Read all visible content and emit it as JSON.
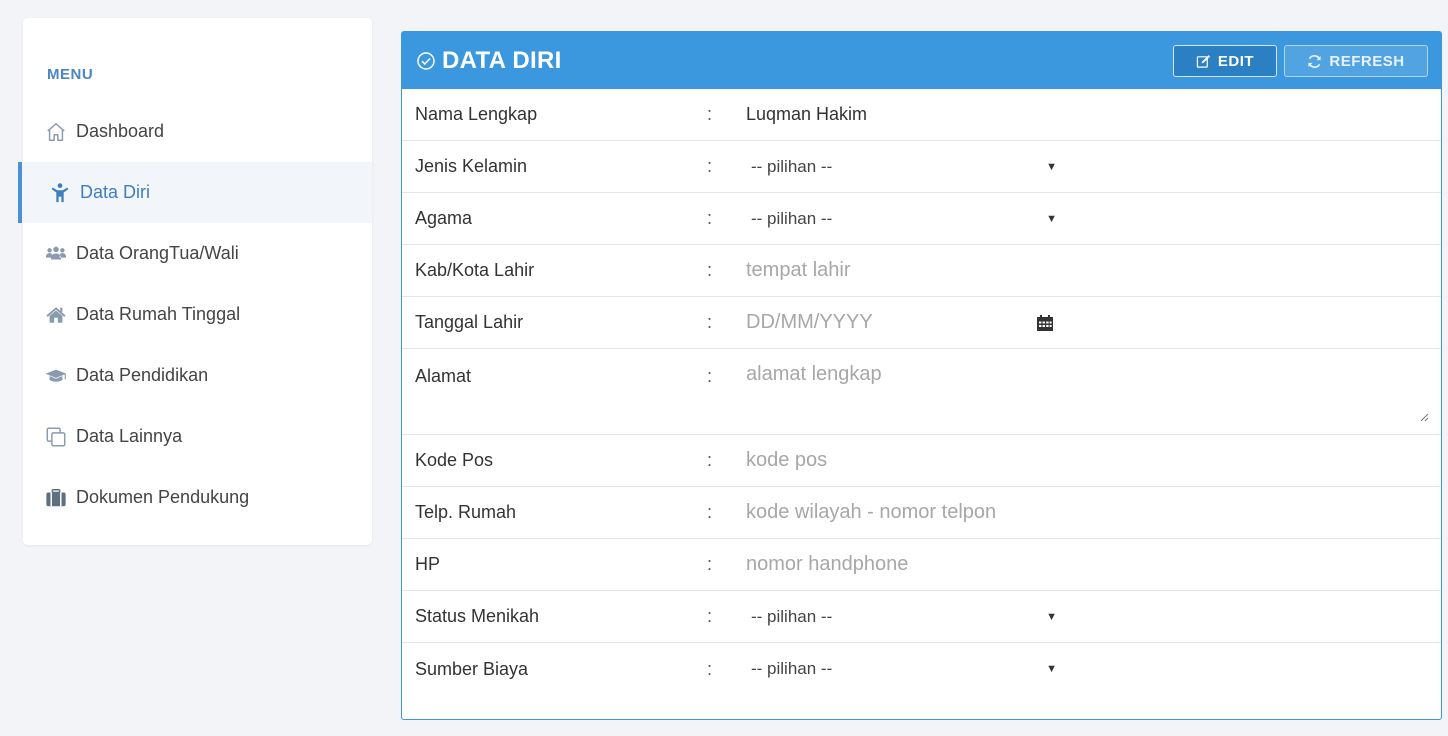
{
  "sidebar": {
    "heading": "MENU",
    "items": [
      {
        "label": "Dashboard",
        "icon": "home-outline-icon",
        "active": false
      },
      {
        "label": "Data Diri",
        "icon": "child-icon",
        "active": true
      },
      {
        "label": "Data OrangTua/Wali",
        "icon": "users-icon",
        "active": false
      },
      {
        "label": "Data Rumah Tinggal",
        "icon": "house-icon",
        "active": false
      },
      {
        "label": "Data Pendidikan",
        "icon": "graduation-cap-icon",
        "active": false
      },
      {
        "label": "Data Lainnya",
        "icon": "clone-icon",
        "active": false
      },
      {
        "label": "Dokumen Pendukung",
        "icon": "suitcase-icon",
        "active": false
      }
    ]
  },
  "panel": {
    "title": "DATA DIRI",
    "title_icon": "check-circle-icon",
    "edit_label": "EDIT",
    "refresh_label": "REFRESH",
    "colon": ":",
    "fields": {
      "nama": {
        "label": "Nama Lengkap",
        "value": "Luqman Hakim"
      },
      "jenis_kelamin": {
        "label": "Jenis Kelamin",
        "selected": "-- pilihan --"
      },
      "agama": {
        "label": "Agama",
        "selected": "-- pilihan --"
      },
      "kota_lahir": {
        "label": "Kab/Kota Lahir",
        "placeholder": "tempat lahir"
      },
      "tanggal_lahir": {
        "label": "Tanggal Lahir",
        "placeholder": "DD/MM/YYYY"
      },
      "alamat": {
        "label": "Alamat",
        "placeholder": "alamat lengkap"
      },
      "kode_pos": {
        "label": "Kode Pos",
        "placeholder": "kode pos"
      },
      "telp_rumah": {
        "label": "Telp. Rumah",
        "placeholder": "kode wilayah - nomor telpon"
      },
      "hp": {
        "label": "HP",
        "placeholder": "nomor handphone"
      },
      "status_menikah": {
        "label": "Status Menikah",
        "selected": "-- pilihan --"
      },
      "sumber_biaya": {
        "label": "Sumber Biaya",
        "selected": "-- pilihan --"
      }
    }
  },
  "colors": {
    "accent": "#3b97de",
    "active_text": "#3f7fbf",
    "menu_heading": "#4a86c5",
    "background": "#f3f4f8"
  }
}
